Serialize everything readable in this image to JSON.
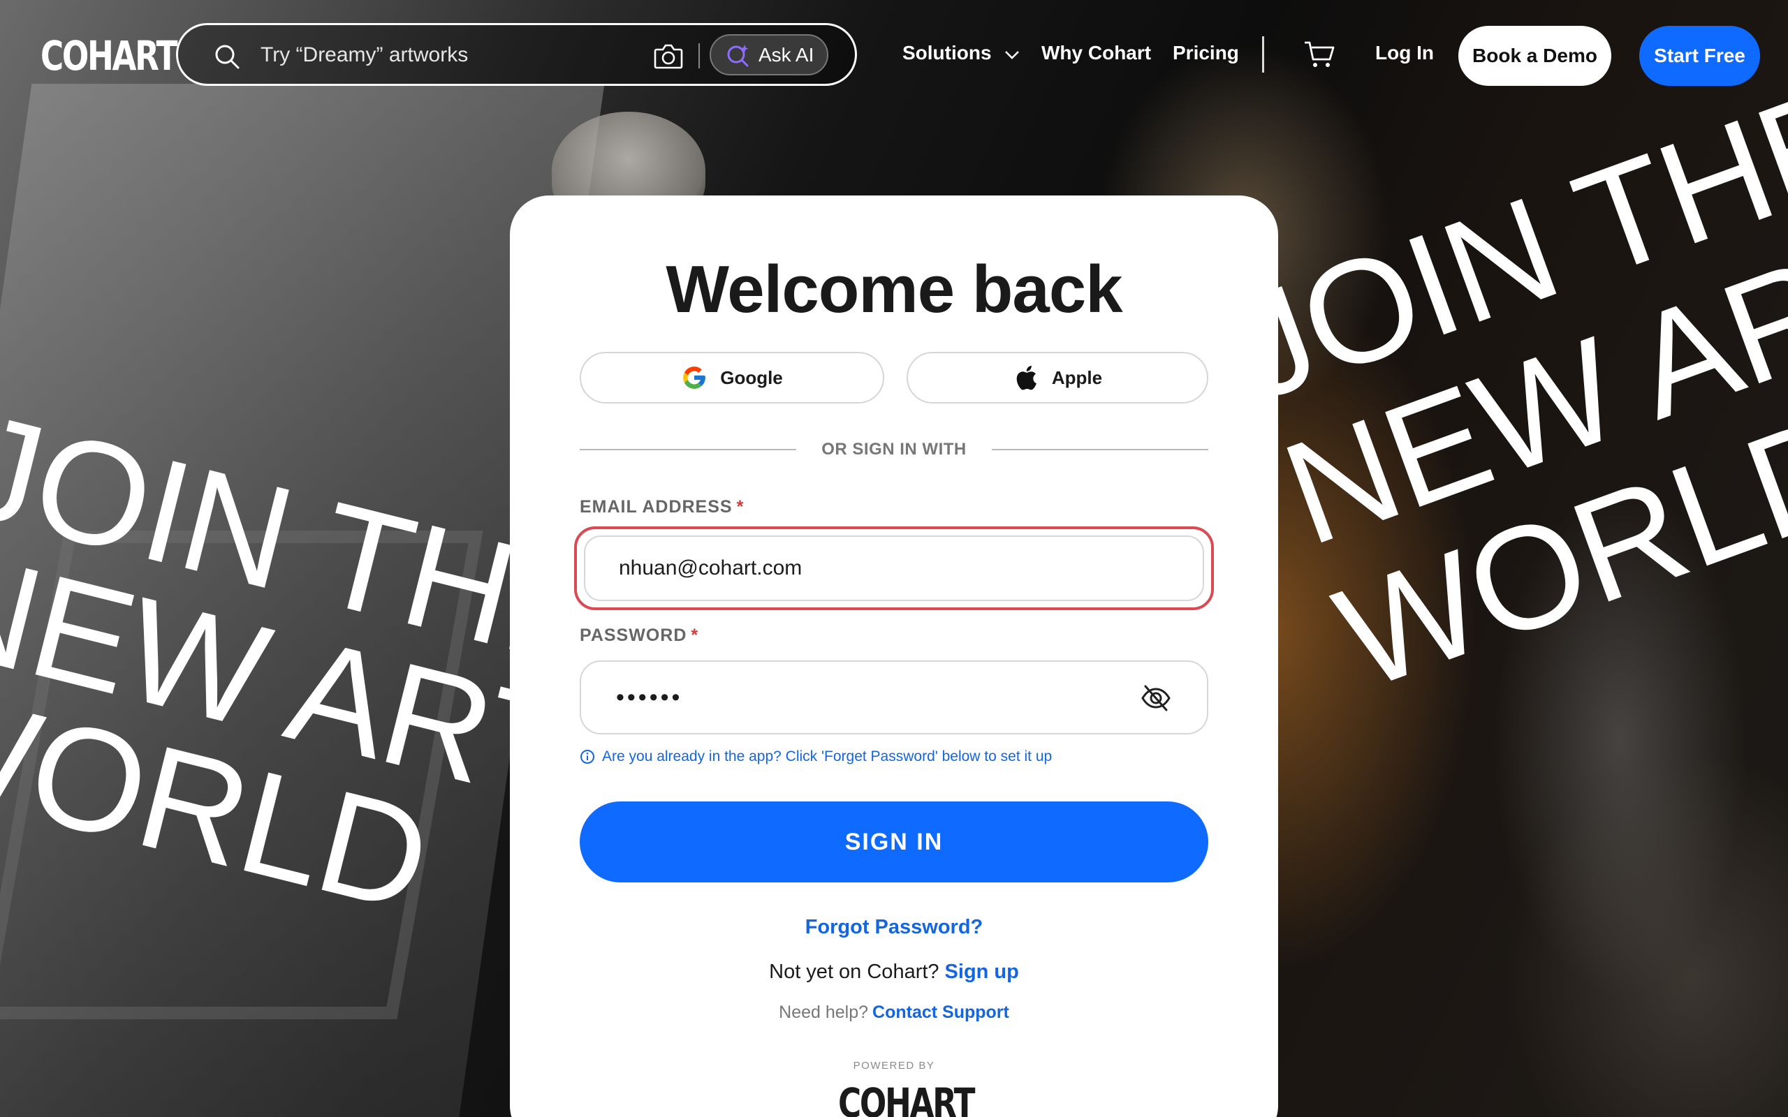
{
  "header": {
    "logo": "COHART",
    "search_placeholder": "Try “Dreamy” artworks",
    "ask_ai_label": "Ask AI",
    "nav": {
      "solutions": "Solutions",
      "why": "Why Cohart",
      "pricing": "Pricing",
      "login": "Log In"
    },
    "book_demo": "Book a Demo",
    "start_free": "Start Free",
    "icons": [
      "search-icon",
      "camera-icon",
      "sparkle-search-icon",
      "chevron-down-icon",
      "cart-icon"
    ]
  },
  "background": {
    "left_lines": [
      "JOIN THE",
      "NEW ART",
      "WORLD"
    ],
    "right_lines": [
      "JOIN THE",
      "NEW ART",
      "WORLD"
    ]
  },
  "login": {
    "title": "Welcome back",
    "google_label": "Google",
    "apple_label": "Apple",
    "divider_text": "OR SIGN IN WITH",
    "email_label": "EMAIL ADDRESS",
    "email_value": "nhuan@cohart.com",
    "password_label": "PASSWORD",
    "password_value": "••••••",
    "required_mark": "*",
    "hint": "Are you already in the app? Click 'Forget Password' below to set it up",
    "sign_in": "SIGN IN",
    "forgot": "Forgot Password?",
    "signup_prompt": "Not yet on Cohart?",
    "signup_link": "Sign up",
    "help_prompt": "Need help?",
    "help_link": "Contact Support",
    "powered_by": "POWERED BY",
    "footer_logo": "COHART"
  },
  "colors": {
    "accent_blue": "#0f6bff",
    "link_blue": "#1466e0",
    "error_red": "#d94a52",
    "card_bg": "#ffffff"
  }
}
